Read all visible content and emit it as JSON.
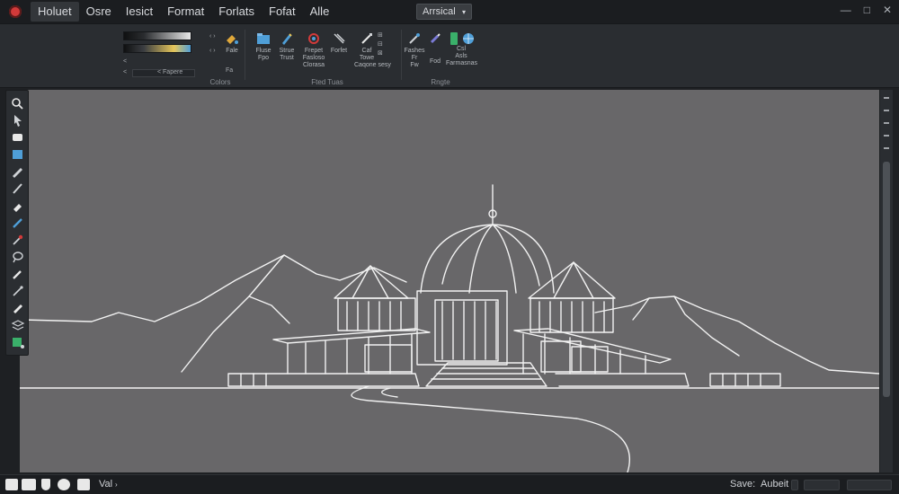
{
  "menu": {
    "items": [
      "Holuet",
      "Osre",
      "Iesict",
      "Format",
      "Forlats",
      "Fofat",
      "Alle"
    ],
    "active_index": 0
  },
  "toolbar_dropdown": {
    "value": "Arrsical"
  },
  "window_controls": {
    "minimize": "—",
    "maximize": "□",
    "close": "✕"
  },
  "ribbon": {
    "colors_group": {
      "label": "Colors",
      "small_labels": [
        "<",
        "<",
        "< Fapere",
        "Fale",
        "Fa"
      ]
    },
    "edit_tools_group": {
      "label": "Fted Tuas",
      "tools": [
        {
          "label": "Fluse\nFpo",
          "icon": "folder-icon"
        },
        {
          "label": "Strue\nTrust",
          "icon": "pen-icon"
        },
        {
          "label": "Frepet\nFasloso\nClorasa",
          "icon": "brush-icon"
        },
        {
          "label": "Forfet",
          "icon": "pencil-icon"
        },
        {
          "label": "Caf\nTowe\nCaqone sesy",
          "icon": "eraser-icon"
        }
      ]
    },
    "right_group": {
      "label": "Rngte",
      "tools": [
        {
          "label": "Fashes\nFr\nFw",
          "icon": "eyedropper-icon"
        },
        {
          "label": "Fod",
          "icon": "marker-icon"
        },
        {
          "label": "Csl\nAsls\nFarmasnas",
          "icon": "globe-icon"
        }
      ]
    }
  },
  "palette": {
    "tools": [
      "zoom-icon",
      "select-icon",
      "bucket-icon",
      "square-icon",
      "pen-icon",
      "brush-icon",
      "eraser-icon",
      "pencil-icon",
      "eyedropper-icon",
      "lasso-icon",
      "marker-icon",
      "smudge-icon",
      "clone-icon",
      "layers-icon"
    ]
  },
  "status": {
    "left_label": "Val",
    "save_label": "Save:",
    "save_value": "Aubeit"
  },
  "colors": {
    "canvas_bg": "#686769",
    "chrome_bg": "#2a2d31",
    "sketch_line": "#f2f2f2",
    "accent_red": "#d23a3a",
    "accent_blue": "#4f9fd8"
  }
}
